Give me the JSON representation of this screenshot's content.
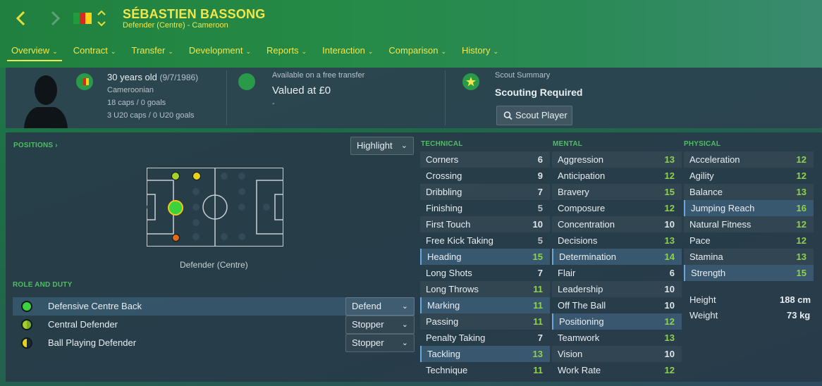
{
  "header": {
    "back_icon": "chevron-left-icon",
    "forward_icon": "chevron-right-icon",
    "flag_colors": [
      "#1f9a3c",
      "#d52b1e",
      "#fcd116"
    ],
    "player_name": "SÉBASTIEN BASSONG",
    "player_subtitle": "Defender (Centre) - Cameroon"
  },
  "tabs": [
    {
      "label": "Overview"
    },
    {
      "label": "Contract"
    },
    {
      "label": "Transfer"
    },
    {
      "label": "Development"
    },
    {
      "label": "Reports"
    },
    {
      "label": "Interaction"
    },
    {
      "label": "Comparison"
    },
    {
      "label": "History"
    }
  ],
  "info": {
    "age": "30 years old",
    "dob": "(9/7/1986)",
    "nationality": "Cameroonian",
    "caps": "18 caps / 0 goals",
    "u20_caps": "3 U20 caps / 0 U20 goals",
    "transfer_status": "Available on a free transfer",
    "value": "Valued at £0",
    "value_sub": "-",
    "scout_label": "Scout Summary",
    "scout_status": "Scouting Required",
    "scout_button": "Scout Player"
  },
  "positions": {
    "title": "POSITIONS ›",
    "highlight_label": "Highlight",
    "position_label": "Defender (Centre)"
  },
  "role_duty": {
    "title": "ROLE AND DUTY",
    "roles": [
      {
        "name": "Defensive Centre Back",
        "duty": "Defend"
      },
      {
        "name": "Central Defender",
        "duty": "Stopper"
      },
      {
        "name": "Ball Playing Defender",
        "duty": "Stopper"
      }
    ]
  },
  "technical": {
    "title": "TECHNICAL",
    "attrs": [
      {
        "name": "Corners",
        "value": "6"
      },
      {
        "name": "Crossing",
        "value": "9"
      },
      {
        "name": "Dribbling",
        "value": "7"
      },
      {
        "name": "Finishing",
        "value": "5"
      },
      {
        "name": "First Touch",
        "value": "10"
      },
      {
        "name": "Free Kick Taking",
        "value": "5"
      },
      {
        "name": "Heading",
        "value": "15"
      },
      {
        "name": "Long Shots",
        "value": "7"
      },
      {
        "name": "Long Throws",
        "value": "11"
      },
      {
        "name": "Marking",
        "value": "11"
      },
      {
        "name": "Passing",
        "value": "11"
      },
      {
        "name": "Penalty Taking",
        "value": "7"
      },
      {
        "name": "Tackling",
        "value": "13"
      },
      {
        "name": "Technique",
        "value": "11"
      }
    ]
  },
  "mental": {
    "title": "MENTAL",
    "attrs": [
      {
        "name": "Aggression",
        "value": "13"
      },
      {
        "name": "Anticipation",
        "value": "12"
      },
      {
        "name": "Bravery",
        "value": "15"
      },
      {
        "name": "Composure",
        "value": "12"
      },
      {
        "name": "Concentration",
        "value": "10"
      },
      {
        "name": "Decisions",
        "value": "13"
      },
      {
        "name": "Determination",
        "value": "14"
      },
      {
        "name": "Flair",
        "value": "6"
      },
      {
        "name": "Leadership",
        "value": "10"
      },
      {
        "name": "Off The Ball",
        "value": "10"
      },
      {
        "name": "Positioning",
        "value": "12"
      },
      {
        "name": "Teamwork",
        "value": "13"
      },
      {
        "name": "Vision",
        "value": "10"
      },
      {
        "name": "Work Rate",
        "value": "12"
      }
    ]
  },
  "physical": {
    "title": "PHYSICAL",
    "attrs": [
      {
        "name": "Acceleration",
        "value": "12"
      },
      {
        "name": "Agility",
        "value": "12"
      },
      {
        "name": "Balance",
        "value": "13"
      },
      {
        "name": "Jumping Reach",
        "value": "16"
      },
      {
        "name": "Natural Fitness",
        "value": "12"
      },
      {
        "name": "Pace",
        "value": "12"
      },
      {
        "name": "Stamina",
        "value": "13"
      },
      {
        "name": "Strength",
        "value": "15"
      }
    ],
    "height_label": "Height",
    "height_value": "188 cm",
    "weight_label": "Weight",
    "weight_value": "73 kg"
  },
  "colors": {
    "accent": "#f2e64a",
    "section_green": "#4fbd64",
    "value_green": "#8fd14f"
  }
}
